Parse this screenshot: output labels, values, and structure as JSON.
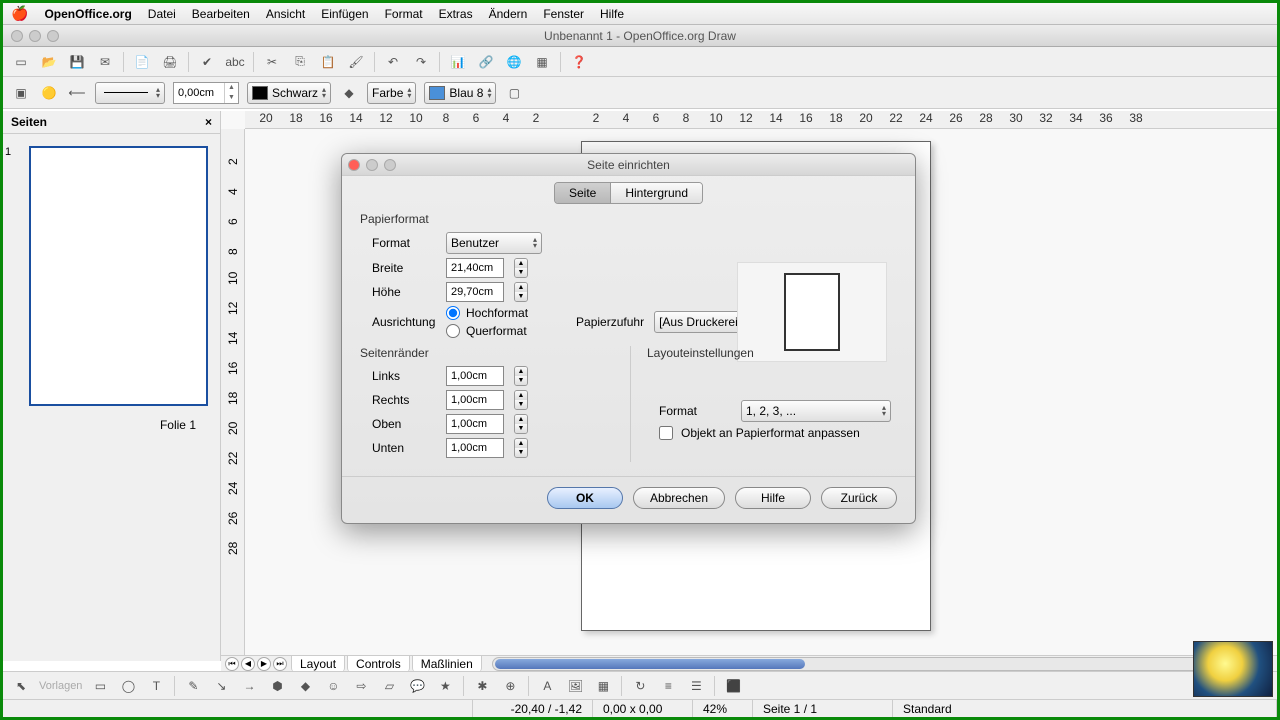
{
  "menubar": {
    "app": "OpenOffice.org",
    "items": [
      "Datei",
      "Bearbeiten",
      "Ansicht",
      "Einfügen",
      "Format",
      "Extras",
      "Ändern",
      "Fenster",
      "Hilfe"
    ]
  },
  "window": {
    "title": "Unbenannt 1 - OpenOffice.org Draw"
  },
  "toolbar2": {
    "linewidth": "0,00cm",
    "linecolor": "Schwarz",
    "fillmode": "Farbe",
    "fillcolor": "Blau 8"
  },
  "sidepanel": {
    "title": "Seiten",
    "page_num": "1",
    "caption": "Folie 1"
  },
  "ruler_h": [
    "20",
    "18",
    "16",
    "14",
    "12",
    "10",
    "8",
    "6",
    "4",
    "2",
    "",
    "2",
    "4",
    "6",
    "8",
    "10",
    "12",
    "14",
    "16",
    "18",
    "20",
    "22",
    "24",
    "26",
    "28",
    "30",
    "32",
    "34",
    "36",
    "38"
  ],
  "ruler_v": [
    "2",
    "4",
    "6",
    "8",
    "10",
    "12",
    "14",
    "16",
    "18",
    "20",
    "22",
    "24",
    "26",
    "28"
  ],
  "dialog": {
    "title": "Seite einrichten",
    "tabs": {
      "page": "Seite",
      "background": "Hintergrund"
    },
    "paperformat": {
      "section": "Papierformat",
      "format_lbl": "Format",
      "format_val": "Benutzer",
      "width_lbl": "Breite",
      "width_val": "21,40cm",
      "height_lbl": "Höhe",
      "height_val": "29,70cm",
      "orient_lbl": "Ausrichtung",
      "portrait": "Hochformat",
      "landscape": "Querformat",
      "tray_lbl": "Papierzufuhr",
      "tray_val": "[Aus Druckereinstellun"
    },
    "margins": {
      "section": "Seitenränder",
      "left_lbl": "Links",
      "left_val": "1,00cm",
      "right_lbl": "Rechts",
      "right_val": "1,00cm",
      "top_lbl": "Oben",
      "top_val": "1,00cm",
      "bottom_lbl": "Unten",
      "bottom_val": "1,00cm"
    },
    "layout": {
      "section": "Layouteinstellungen",
      "format_lbl": "Format",
      "format_val": "1, 2, 3, ...",
      "fit_lbl": "Objekt an Papierformat anpassen"
    },
    "buttons": {
      "ok": "OK",
      "cancel": "Abbrechen",
      "help": "Hilfe",
      "reset": "Zurück"
    }
  },
  "bottom_tabs": {
    "layout": "Layout",
    "controls": "Controls",
    "dimlines": "Maßlinien"
  },
  "bottom_toolbar": {
    "templates": "Vorlagen"
  },
  "status": {
    "pos": "-20,40 / -1,42",
    "size": "0,00 x 0,00",
    "zoom": "42%",
    "page": "Seite 1 / 1",
    "style": "Standard"
  }
}
